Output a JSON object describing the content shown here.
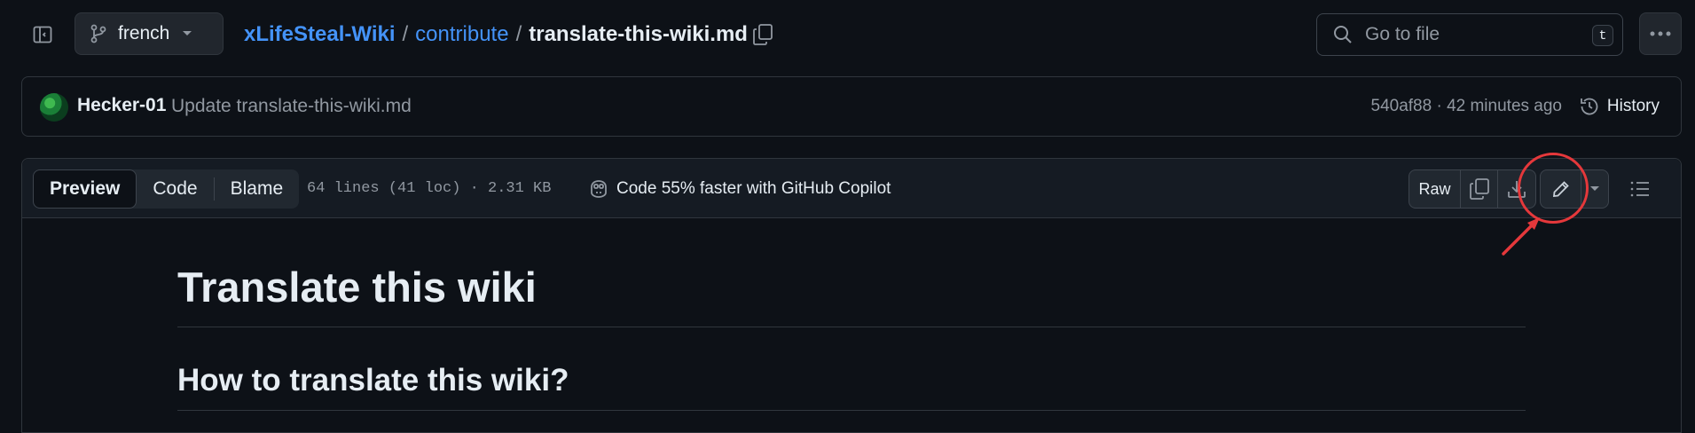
{
  "topbar": {
    "branch": "french",
    "breadcrumb": {
      "repo": "xLifeSteal-Wiki",
      "sep": "/",
      "dir": "contribute",
      "file": "translate-this-wiki.md"
    },
    "search_placeholder": "Go to file",
    "search_shortcut": "t"
  },
  "commit": {
    "author": "Hecker-01",
    "message": "Update translate-this-wiki.md",
    "meta": "540af88 · 42 minutes ago",
    "history_label": "History"
  },
  "file_header": {
    "tabs": [
      {
        "label": "Preview",
        "active": true
      },
      {
        "label": "Code",
        "active": false
      },
      {
        "label": "Blame",
        "active": false
      }
    ],
    "info": "64 lines (41 loc) · 2.31 KB",
    "copilot_text": "Code 55% faster with GitHub Copilot",
    "raw_label": "Raw"
  },
  "content": {
    "h1": "Translate this wiki",
    "h2": "How to translate this wiki?"
  },
  "colors": {
    "background": "#0d1117",
    "link": "#4493f8",
    "annotation": "#e5383b"
  }
}
